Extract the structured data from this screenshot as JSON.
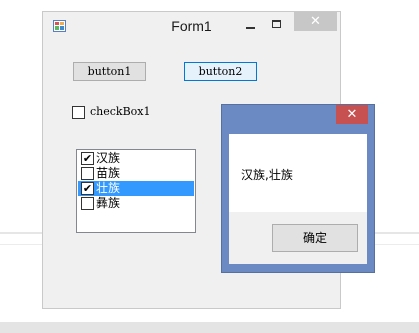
{
  "window": {
    "title": "Form1",
    "close_glyph": "✕",
    "icon": "app-icon"
  },
  "buttons": {
    "button1": "button1",
    "button2": "button2"
  },
  "checkbox1": {
    "label": "checkBox1",
    "checked": false
  },
  "listbox": {
    "items": [
      {
        "label": "汉族",
        "checked": true,
        "mark": "✔"
      },
      {
        "label": "苗族",
        "checked": false,
        "mark": ""
      },
      {
        "label": "壮族",
        "checked": true,
        "mark": "✔",
        "selected": true
      },
      {
        "label": "彝族",
        "checked": false,
        "mark": ""
      }
    ]
  },
  "messagebox": {
    "close_glyph": "✕",
    "message": "汉族,壮族",
    "ok_label": "确定"
  },
  "colors": {
    "selection": "#3399ff",
    "dialog_frame": "#6b89c2",
    "dialog_close": "#c75050"
  }
}
